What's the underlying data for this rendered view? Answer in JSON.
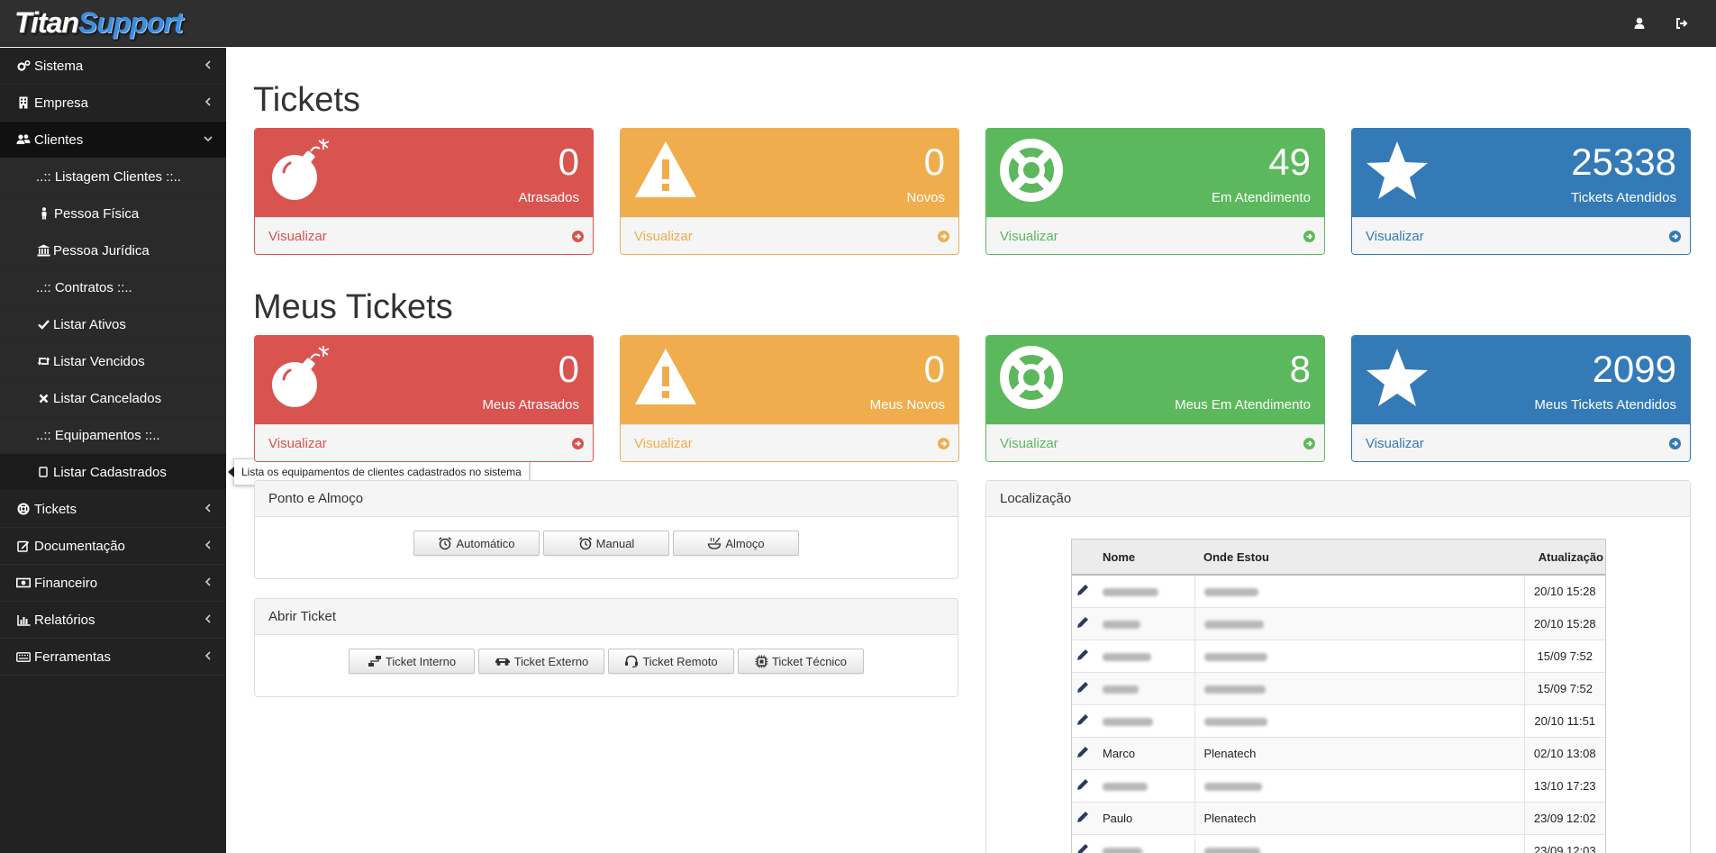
{
  "brand": {
    "part1": "Titan",
    "part2": "Support"
  },
  "sidebar": {
    "items": [
      {
        "label": "Sistema",
        "icon": "cogs-icon"
      },
      {
        "label": "Empresa",
        "icon": "building-icon"
      },
      {
        "label": "Clientes",
        "icon": "users-icon"
      }
    ],
    "sub_items": [
      {
        "label": "..:: Listagem Clientes ::..",
        "icon": ""
      },
      {
        "label": "Pessoa Física",
        "icon": "person-icon"
      },
      {
        "label": "Pessoa Jurídica",
        "icon": "bank-icon"
      },
      {
        "label": "..:: Contratos ::..",
        "icon": ""
      },
      {
        "label": "Listar Ativos",
        "icon": "check-icon"
      },
      {
        "label": "Listar Vencidos",
        "icon": "retweet-icon"
      },
      {
        "label": "Listar Cancelados",
        "icon": "x-icon"
      },
      {
        "label": "..:: Equipamentos ::..",
        "icon": ""
      },
      {
        "label": "Listar Cadastrados",
        "icon": "square-icon"
      }
    ],
    "items_bottom": [
      {
        "label": "Tickets",
        "icon": "lifebuoy-icon"
      },
      {
        "label": "Documentação",
        "icon": "edit-icon"
      },
      {
        "label": "Financeiro",
        "icon": "money-icon"
      },
      {
        "label": "Relatórios",
        "icon": "bar-chart-icon"
      },
      {
        "label": "Ferramentas",
        "icon": "keyboard-icon"
      }
    ]
  },
  "tooltip": "Lista os equipamentos de clientes cadastrados no sistema",
  "tickets": {
    "title": "Tickets",
    "panels": [
      {
        "value": "0",
        "caption": "Atrasados",
        "link": "Visualizar",
        "color": "#d9534f",
        "icon": "bomb-icon"
      },
      {
        "value": "0",
        "caption": "Novos",
        "link": "Visualizar",
        "color": "#f0ad4e",
        "icon": "warning-icon"
      },
      {
        "value": "49",
        "caption": "Em Atendimento",
        "link": "Visualizar",
        "color": "#5cb85c",
        "icon": "lifebuoy-icon"
      },
      {
        "value": "25338",
        "caption": "Tickets Atendidos",
        "link": "Visualizar",
        "color": "#337ab7",
        "icon": "star-icon"
      }
    ]
  },
  "my_tickets": {
    "title": "Meus Tickets",
    "panels": [
      {
        "value": "0",
        "caption": "Meus Atrasados",
        "link": "Visualizar",
        "color": "#d9534f",
        "icon": "bomb-icon"
      },
      {
        "value": "0",
        "caption": "Meus Novos",
        "link": "Visualizar",
        "color": "#f0ad4e",
        "icon": "warning-icon"
      },
      {
        "value": "8",
        "caption": "Meus Em Atendimento",
        "link": "Visualizar",
        "color": "#5cb85c",
        "icon": "lifebuoy-icon"
      },
      {
        "value": "2099",
        "caption": "Meus Tickets Atendidos",
        "link": "Visualizar",
        "color": "#337ab7",
        "icon": "star-icon"
      }
    ]
  },
  "ponto": {
    "title": "Ponto e Almoço",
    "buttons": [
      "Automático",
      "Manual",
      "Almoço"
    ]
  },
  "abrir": {
    "title": "Abrir Ticket",
    "buttons": [
      "Ticket Interno",
      "Ticket Externo",
      "Ticket Remoto",
      "Ticket Técnico"
    ]
  },
  "localizacao": {
    "title": "Localização",
    "columns": [
      "Nome",
      "Onde Estou",
      "Atualização"
    ],
    "rows": [
      {
        "nome": "",
        "onde": "",
        "upd": "20/10 15:28"
      },
      {
        "nome": "",
        "onde": "",
        "upd": "20/10 15:28"
      },
      {
        "nome": "",
        "onde": "",
        "upd": "15/09 7:52"
      },
      {
        "nome": "",
        "onde": "",
        "upd": "15/09 7:52"
      },
      {
        "nome": "",
        "onde": "",
        "upd": "20/10 11:51"
      },
      {
        "nome": "Marco",
        "onde": "Plenatech",
        "upd": "02/10 13:08"
      },
      {
        "nome": "",
        "onde": "",
        "upd": "13/10 17:23"
      },
      {
        "nome": "Paulo",
        "onde": "Plenatech",
        "upd": "23/09 12:02"
      },
      {
        "nome": "",
        "onde": "",
        "upd": "23/09 12:03"
      }
    ]
  }
}
